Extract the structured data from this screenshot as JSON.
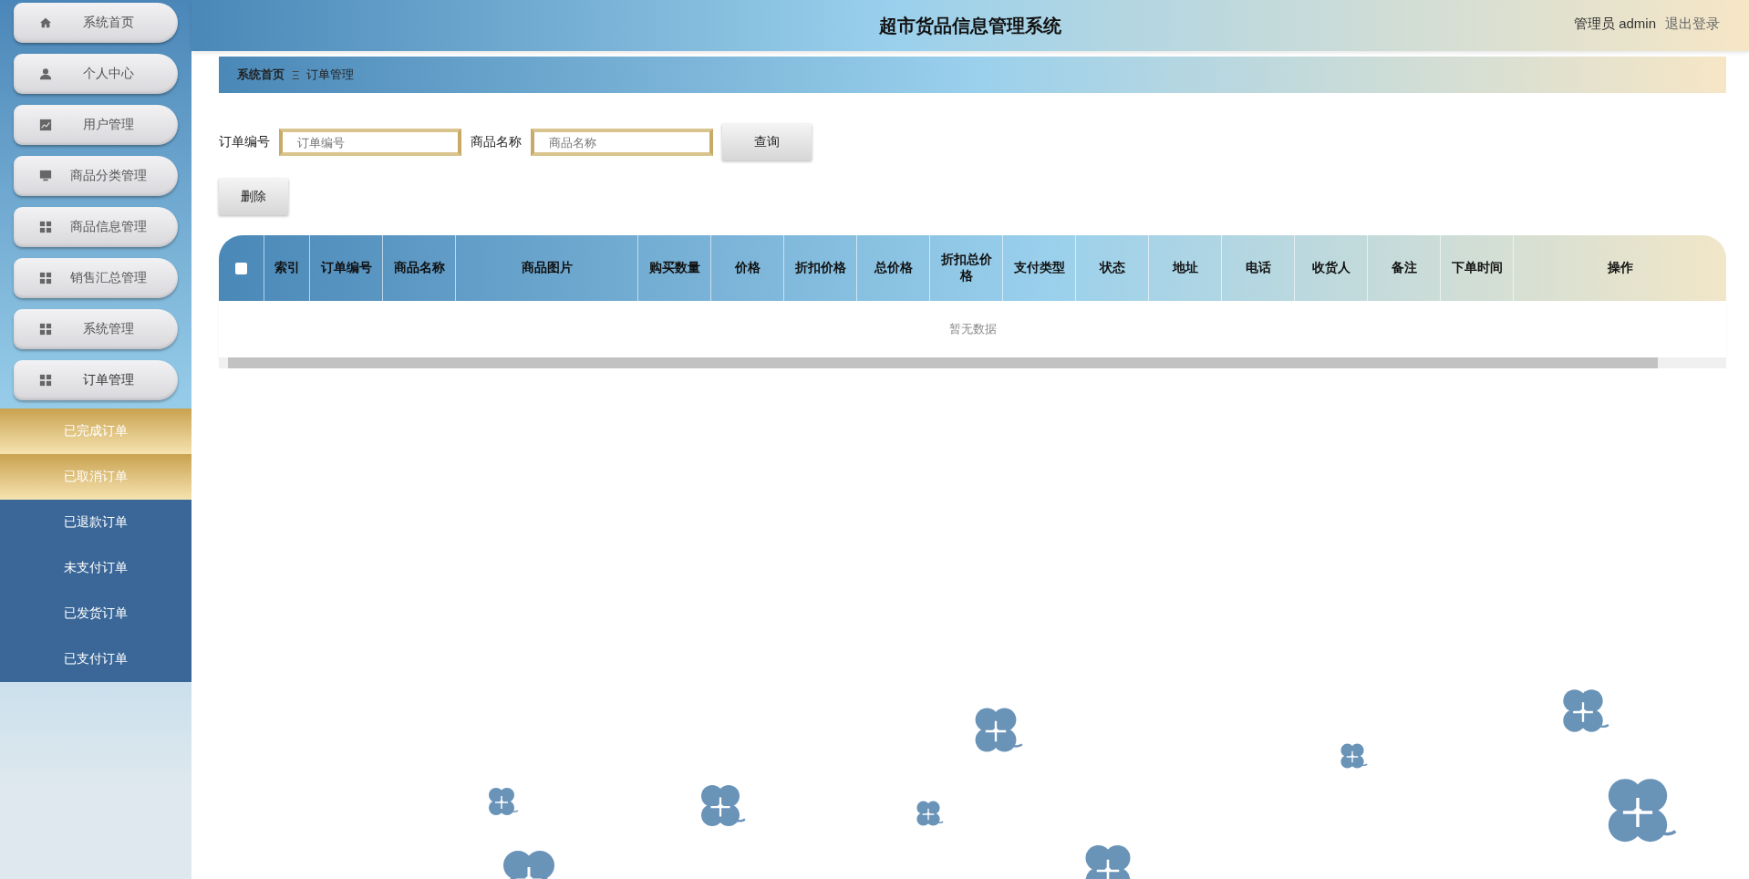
{
  "header": {
    "title": "超市货品信息管理系统",
    "user_label": "管理员 admin",
    "logout": "退出登录"
  },
  "sidebar": {
    "items": [
      {
        "label": "系统首页",
        "kind": "home"
      },
      {
        "label": "个人中心",
        "kind": "person"
      },
      {
        "label": "用户管理",
        "kind": "chart"
      },
      {
        "label": "商品分类管理",
        "kind": "monitor"
      },
      {
        "label": "商品信息管理",
        "kind": "grid"
      },
      {
        "label": "销售汇总管理",
        "kind": "grid"
      },
      {
        "label": "系统管理",
        "kind": "grid"
      },
      {
        "label": "订单管理",
        "kind": "grid",
        "expanded": true,
        "children": [
          {
            "label": "已完成订单",
            "highlighted": true
          },
          {
            "label": "已取消订单",
            "highlighted": true
          },
          {
            "label": "已退款订单",
            "highlighted": false
          },
          {
            "label": "未支付订单",
            "highlighted": false
          },
          {
            "label": "已发货订单",
            "highlighted": false
          },
          {
            "label": "已支付订单",
            "highlighted": false
          }
        ]
      }
    ]
  },
  "breadcrumb": {
    "home": "系统首页",
    "separator": "Ξ",
    "current": "订单管理"
  },
  "search": {
    "fields": [
      {
        "label": "订单编号",
        "placeholder": "订单编号"
      },
      {
        "label": "商品名称",
        "placeholder": "商品名称"
      }
    ],
    "button": "查询"
  },
  "delete_button": "删除",
  "table": {
    "select_all_checked": false,
    "columns": [
      "索引",
      "订单编号",
      "商品名称",
      "商品图片",
      "购买数量",
      "价格",
      "折扣价格",
      "总价格",
      "折扣总价格",
      "支付类型",
      "状态",
      "地址",
      "电话",
      "收货人",
      "备注",
      "下单时间",
      "操作"
    ],
    "empty_text": "暂无数据"
  }
}
